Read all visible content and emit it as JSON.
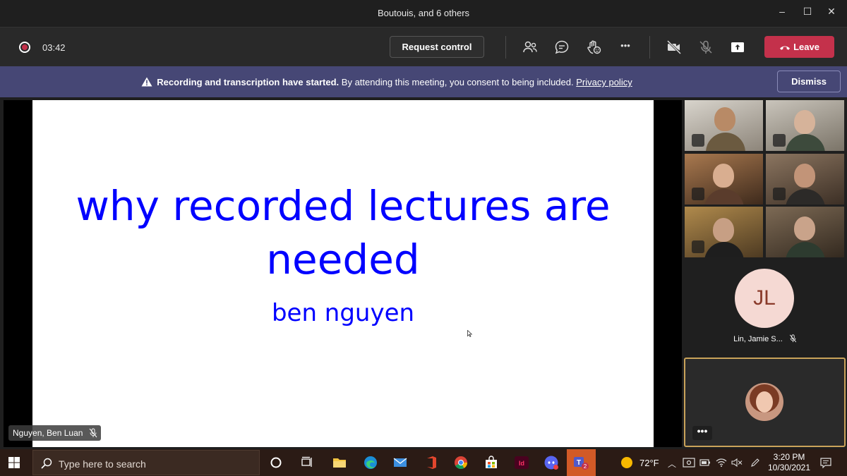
{
  "window": {
    "title": "Boutouis, and 6 others",
    "minimize_glyph": "–",
    "maximize_glyph": "☐",
    "close_glyph": "✕"
  },
  "toolbar": {
    "timer": "03:42",
    "request_control_label": "Request control",
    "leave_label": "Leave",
    "more_glyph": "•••"
  },
  "banner": {
    "bold_text": "Recording and transcription have started.",
    "text": " By attending this meeting, you consent to being included. ",
    "link_text": "Privacy policy",
    "dismiss_label": "Dismiss"
  },
  "slide": {
    "title": "why recorded lectures are needed",
    "subtitle": "ben nguyen"
  },
  "presenter": {
    "name": "Nguyen, Ben Luan"
  },
  "participants": [
    {
      "name": "Lin, Jamie S...",
      "initials": "JL"
    }
  ],
  "self_tile": {
    "more_glyph": "•••"
  },
  "taskbar": {
    "search_placeholder": "Type here to search",
    "temperature": "72°F",
    "time": "3:20 PM",
    "date": "10/30/2021",
    "teams_badge": "2"
  },
  "colors": {
    "leave": "#c4314b",
    "banner": "#464775",
    "slide_text": "#0000ff",
    "taskbar_active": "#d25a27",
    "self_tile_border": "#c9a35a"
  }
}
